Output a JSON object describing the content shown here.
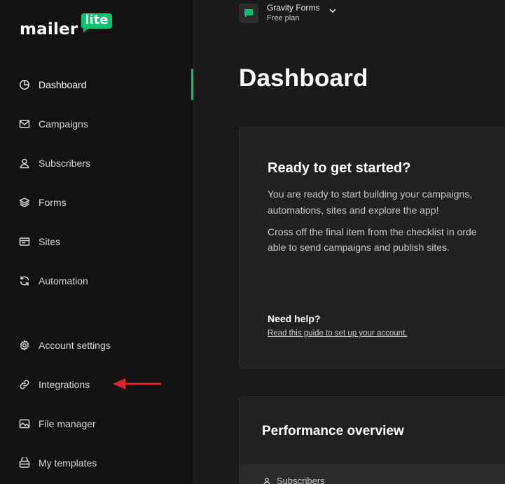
{
  "logo": {
    "main": "mailer",
    "badge": "lite"
  },
  "colors": {
    "accent": "#09c269",
    "arrow": "#e0242b"
  },
  "sidebar": {
    "items": [
      {
        "label": "Dashboard",
        "icon": "dashboard-icon"
      },
      {
        "label": "Campaigns",
        "icon": "mail-icon"
      },
      {
        "label": "Subscribers",
        "icon": "user-icon"
      },
      {
        "label": "Forms",
        "icon": "layers-icon"
      },
      {
        "label": "Sites",
        "icon": "browser-icon"
      },
      {
        "label": "Automation",
        "icon": "refresh-icon"
      },
      {
        "label": "Account settings",
        "icon": "gear-icon"
      },
      {
        "label": "Integrations",
        "icon": "link-icon"
      },
      {
        "label": "File manager",
        "icon": "image-icon"
      },
      {
        "label": "My templates",
        "icon": "template-icon"
      }
    ]
  },
  "account": {
    "name": "Gravity Forms",
    "plan": "Free plan"
  },
  "main": {
    "title": "Dashboard",
    "start_card": {
      "title": "Ready to get started?",
      "line1": "You are ready to start building your campaigns,",
      "line2": "automations, sites and explore the app!",
      "line3": "Cross off the final item from the checklist in orde",
      "line4": "able to send campaigns and publish sites.",
      "help_title": "Need help?",
      "help_link": "Read this guide to set up your account."
    },
    "perf_card": {
      "title": "Performance overview",
      "sub_label": "Subscribers"
    }
  }
}
